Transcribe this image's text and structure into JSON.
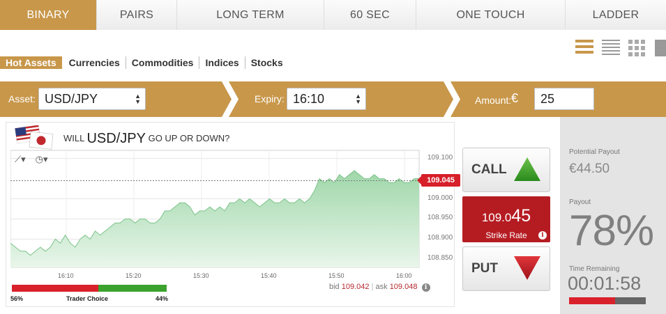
{
  "top_tabs": [
    {
      "label": "BINARY",
      "active": true
    },
    {
      "label": "PAIRS"
    },
    {
      "label": "LONG TERM"
    },
    {
      "label": "60 SEC"
    },
    {
      "label": "ONE TOUCH"
    },
    {
      "label": "LADDER"
    }
  ],
  "category_tabs": [
    {
      "label": "Hot Assets",
      "active": true
    },
    {
      "label": "Currencies"
    },
    {
      "label": "Commodities"
    },
    {
      "label": "Indices"
    },
    {
      "label": "Stocks"
    }
  ],
  "view_icons": [
    "list-view-icon",
    "compact-list-icon",
    "grid-view-icon",
    "single-view-icon"
  ],
  "selector": {
    "asset_label": "Asset:",
    "asset_value": "USD/JPY",
    "expiry_label": "Expiry:",
    "expiry_value": "16:10",
    "amount_label": "Amount:",
    "currency_symbol": "€",
    "amount_value": "25"
  },
  "chart": {
    "question_pre": "WILL",
    "question_asset": "USD/JPY",
    "question_post": "GO UP OR DOWN?",
    "current_rate": "109.045",
    "bid_label": "bid",
    "bid_value": "109.042",
    "ask_label": "ask",
    "ask_value": "109.048",
    "info": "i"
  },
  "chart_data": {
    "type": "area",
    "x_ticks": [
      "16:10",
      "15:20",
      "15:30",
      "15:40",
      "15:50",
      "16:00"
    ],
    "y_ticks": [
      "109.100",
      "109.000",
      "108.950",
      "108.900",
      "108.850"
    ],
    "y_tick_values": [
      109.1,
      109.0,
      108.95,
      108.9,
      108.85
    ],
    "ylim": [
      108.83,
      109.12
    ],
    "current_value": 109.045,
    "values": [
      108.89,
      108.88,
      108.87,
      108.87,
      108.86,
      108.87,
      108.88,
      108.87,
      108.88,
      108.9,
      108.89,
      108.91,
      108.89,
      108.88,
      108.9,
      108.91,
      108.9,
      108.92,
      108.91,
      108.92,
      108.93,
      108.94,
      108.94,
      108.95,
      108.95,
      108.94,
      108.95,
      108.95,
      108.94,
      108.94,
      108.95,
      108.97,
      108.97,
      108.98,
      108.99,
      108.99,
      108.98,
      108.96,
      108.97,
      108.97,
      108.98,
      108.97,
      108.98,
      108.97,
      108.99,
      108.99,
      109.0,
      108.99,
      109.0,
      108.99,
      108.98,
      108.99,
      109.0,
      108.99,
      108.99,
      109.0,
      108.99,
      108.99,
      109.0,
      108.99,
      109.0,
      109.02,
      109.05,
      109.04,
      109.05,
      109.04,
      109.06,
      109.05,
      109.06,
      109.07,
      109.06,
      109.05,
      109.05,
      109.06,
      109.05,
      109.05,
      109.04,
      109.04,
      109.05,
      109.04,
      109.04,
      109.05,
      109.05
    ]
  },
  "trader_choice": {
    "label": "Trader Choice",
    "call_pct": "56%",
    "put_pct": "44%",
    "call_fraction": 0.56
  },
  "buttons": {
    "call_label": "CALL",
    "put_label": "PUT"
  },
  "strike": {
    "value_main": "109.0",
    "value_big": "45",
    "label": "Strike Rate"
  },
  "payout": {
    "potential_label": "Potential Payout",
    "potential_value": "€44.50",
    "payout_label": "Payout",
    "payout_value": "78%",
    "time_label": "Time Remaining",
    "time_value": "00:01:58",
    "time_fraction": 0.6
  },
  "colors": {
    "gold": "#c8974a",
    "red": "#d6202a",
    "green": "#3ba22d"
  }
}
